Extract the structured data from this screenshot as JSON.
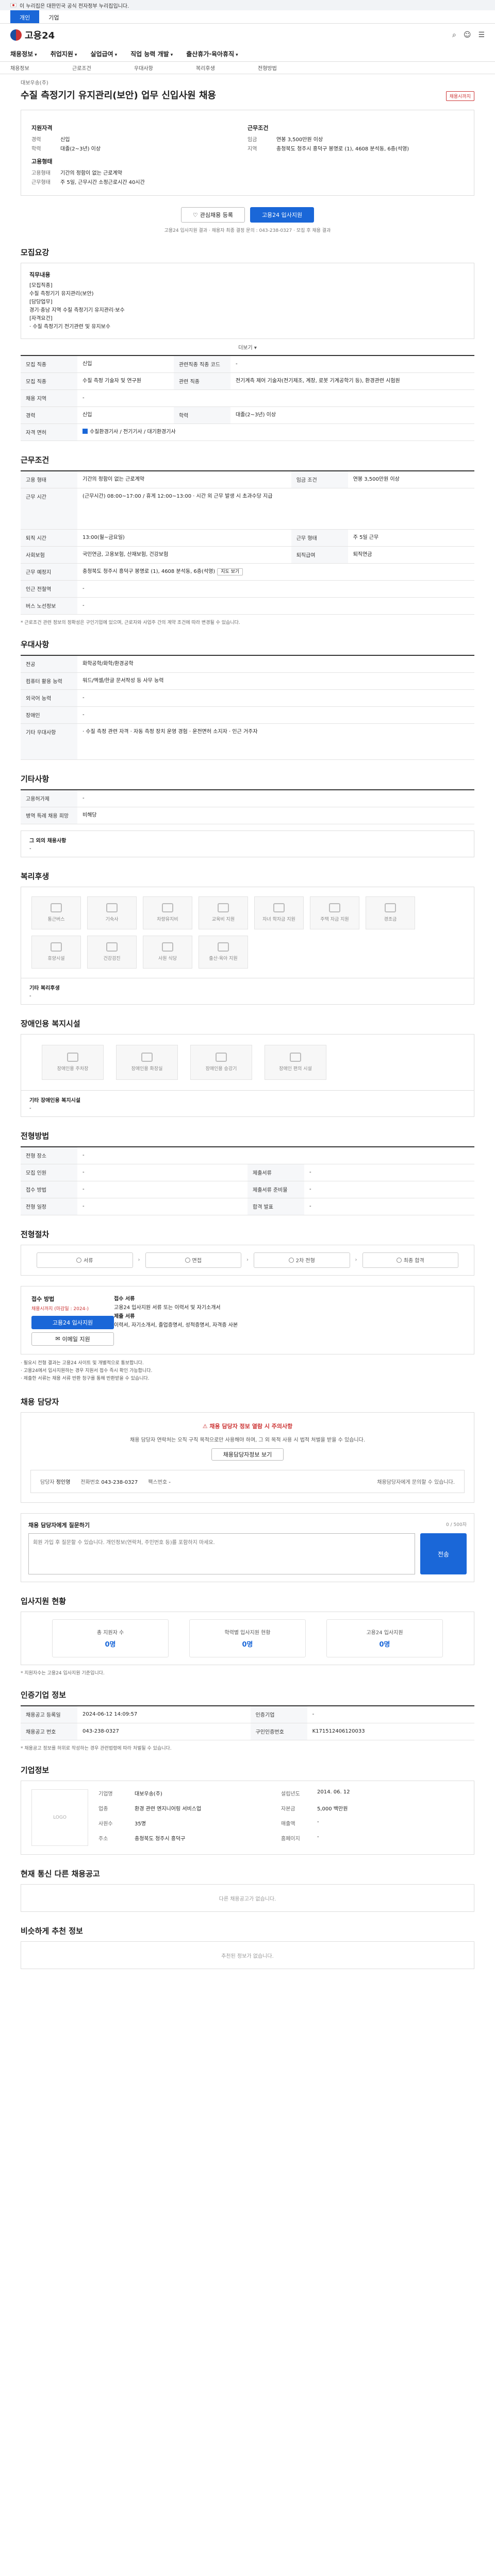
{
  "gov": {
    "text": "이 누리집은 대한민국 공식 전자정부 누리집입니다."
  },
  "tabs": [
    "개인",
    "기업"
  ],
  "logo": "고용24",
  "gnb": [
    "채용정보",
    "취업지원",
    "실업급여",
    "직업 능력 개발",
    "출산휴가·육아휴직"
  ],
  "snb": [
    "채용정보",
    "근로조건",
    "우대사항",
    "복리후생",
    "전형방법"
  ],
  "post": {
    "crumb": "대보우송(주)",
    "title": "수질 측정기기 유지관리(보안) 업무 신입사원 채용",
    "badge": "채용시까지",
    "summary_left_h": "지원자격",
    "summary_left": [
      {
        "k": "경력",
        "v": "신입"
      },
      {
        "k": "학력",
        "v": "대졸(2~3년) 이상"
      }
    ],
    "summary_left_h2": "고용형태",
    "summary_left2": [
      {
        "k": "고용형태",
        "v": "기간의 정함이 없는 근로계약"
      },
      {
        "k": "근무형태",
        "v": "주 5일, 근무시간 소정근로시간 40시간"
      }
    ],
    "summary_right_h": "근무조건",
    "summary_right": [
      {
        "k": "임금",
        "v": "연봉 3,500만원 이상"
      },
      {
        "k": "지역",
        "v": "충청북도 청주시 흥덕구 봉명로 (1), 4608 분석동, 6층(석영)"
      }
    ],
    "btn_like": "관심채용 등록",
    "btn_apply": "고용24 입사지원",
    "apply_note": "고용24 입사지원 결과 · 채용자 최종 결정 문의 : 043-238-0327 · 모집 후 채용 결과"
  },
  "recruit": {
    "h": "모집요강",
    "job_h": "직무내용",
    "job_lines": [
      "[모집직종]",
      "수질 측정기기 유지관리(보안)",
      "[담당업무]",
      "경기·충남 지역 수질 측정기기 유지관리·보수",
      "[자격요건]",
      "· 수질 측정기기 전기관련 및 유지보수"
    ],
    "more": "더보기 ▾",
    "rows": [
      {
        "k": "모집 직종",
        "v": "신입",
        "k2": "관련직종 직종 코드",
        "v2": "-"
      },
      {
        "k": "모집 직종",
        "v": "수질 측정 기술자 및 연구원",
        "k2": "관련 직종",
        "v2": "전기계측 제어 기술자(전기제조, 계장, 로봇 기계공학기 등), 환경관련 시험원"
      },
      {
        "k": "채용 지역",
        "v": "-",
        "k2": "",
        "v2": ""
      },
      {
        "k": "경력",
        "v": "신입",
        "k2": "학력",
        "v2": "대졸(2~3년) 이상"
      },
      {
        "k": "자격 면허",
        "v": "수질환경기사 / 전기기사 / 대기환경기사",
        "k2": "",
        "v2": ""
      }
    ]
  },
  "cond": {
    "h": "근무조건",
    "rows": [
      {
        "k": "고용 형태",
        "v": "기간의 정함이 없는 근로계약",
        "k2": "임금 조건",
        "v2": "연봉 3,500만원 이상"
      },
      {
        "k": "근무 시간",
        "v": "(근무시간) 08:00~17:00 / 휴게 12:00~13:00 · 시간 외 근무 발생 시 초과수당 지급",
        "k2": "",
        "v2": ""
      },
      {
        "k": "퇴직 시간",
        "v": "13:00(월~금요일)",
        "k2": "근무 형태",
        "v2": "주 5일 근무"
      },
      {
        "k": "사회보험",
        "v": "국민연금, 고용보험, 산재보험, 건강보험",
        "k2": "퇴직급여",
        "v2": "퇴직연금"
      },
      {
        "k": "근무 예정지",
        "v": "충청북도 청주시 흥덕구 봉명로 (1), 4608 분석동, 6층(석영)",
        "k2": "",
        "v2": ""
      },
      {
        "k": "인근 전철역",
        "v": "-",
        "k2": "",
        "v2": ""
      },
      {
        "k": "버스 노선정보",
        "v": "-",
        "k2": "",
        "v2": ""
      }
    ],
    "note": "* 근로조건 관련 정보의 정확성은 구인기업에 있으며, 근로자와 사업주 간의 계약 조건에 따라 변경될 수 있습니다."
  },
  "pref": {
    "h": "우대사항",
    "rows": [
      {
        "k": "전공",
        "v": "화학공학/화학/환경공학"
      },
      {
        "k": "컴퓨터 활용 능력",
        "v": "워드/엑셀/한글 문서작성 등 사무 능력"
      },
      {
        "k": "외국어 능력",
        "v": "-"
      },
      {
        "k": "장애인",
        "v": "-"
      },
      {
        "k": "기타 우대사항",
        "v": "· 수질 측정 관련 자격 · 자동 측정 장치 운영 경험 · 운전면허 소지자 · 인근 거주자"
      }
    ]
  },
  "etc": {
    "h": "기타사항",
    "rows": [
      {
        "k": "고용허가제",
        "v": "-"
      },
      {
        "k": "병역 특례 채용 희망",
        "v": "비해당"
      }
    ],
    "sub_h": "그 외의 채용사항",
    "sub_v": "-"
  },
  "welfare": {
    "h": "복리후생",
    "cards": [
      "통근버스",
      "기숙사",
      "차량유지비",
      "교육비 지원",
      "자녀 학자금 지원",
      "주택 자금 지원",
      "경조금",
      "휴양시설",
      "건강검진",
      "사원 식당",
      "출산·육아 지원"
    ],
    "sub_h": "기타 복리후생",
    "sub_v": "-"
  },
  "disab": {
    "h": "장애인용 복지시설",
    "cards": [
      "장애인용 주차장",
      "장애인용 화장실",
      "장애인용 승강기",
      "장애인 편의 시설"
    ],
    "sub_h": "기타 장애인용 복지시설",
    "sub_v": "-"
  },
  "select": {
    "h": "전형방법",
    "rows": [
      {
        "k": "전형 장소",
        "v": "-",
        "k2": "",
        "v2": ""
      },
      {
        "k": "모집 인원",
        "v": "-",
        "k2": "제출서류",
        "v2": "-"
      },
      {
        "k": "접수 방법",
        "v": "-",
        "k2": "제출서류 준비물",
        "v2": "-"
      },
      {
        "k": "전형 일정",
        "v": "-",
        "k2": "합격 발표",
        "v2": "-"
      }
    ]
  },
  "process": {
    "h": "전형절차",
    "steps": [
      "서류",
      "면접",
      "2차 전형",
      "최종 합격"
    ]
  },
  "applyinfo": {
    "h": "접수 방법",
    "deadline": "채용시까지 (마감일 : 2024-)",
    "btn_apply": "고용24 입사지원",
    "btn_email": "이메일 지원",
    "docs_h": "접수 서류",
    "docs": "고용24 입사지원 서류 또는 이력서 및 자기소개서",
    "etc_h": "제출 서류",
    "etc": "이력서, 자기소개서, 졸업증명서, 성적증명서, 자격증 사본",
    "bullets": [
      "· 필요시 전형 결과는 고용24 사이트 및 개별적으로 통보합니다.",
      "· 고용24에서 입사지원하는 경우 지원서 접수 즉시 확인 가능합니다.",
      "· 제출한 서류는 채용 서류 반환 청구를 통해 반환받을 수 있습니다."
    ]
  },
  "manager": {
    "h": "채용 담당자",
    "warn": "⚠ 채용 담당자 정보 열람 시 주의사항",
    "msg": "채용 담당자 연락처는 오직 구직 목적으로만 사용해야 하며, 그 외 목적 사용 시 법적 처벌을 받을 수 있습니다.",
    "btn": "채용담당자정보 보기",
    "name_k": "담당자",
    "name_v": "정인영",
    "tel_k": "전화번호",
    "tel_v": "043-238-0327",
    "fax_k": "팩스번호",
    "note": "채용담당자에게 문의할 수 있습니다."
  },
  "qna": {
    "h": "채용 담당자에게 질문하기",
    "placeholder": "회원 가입 후 질문할 수 있습니다. 개인정보(연락처, 주민번호 등)를 포함하지 마세요.",
    "btn": "전송",
    "count": "0 / 500자"
  },
  "stats": {
    "h": "입사지원 현황",
    "items": [
      {
        "k": "총 지원자 수",
        "v": "0명"
      },
      {
        "k": "학력별 입사지원 현황",
        "v": "0명"
      },
      {
        "k": "고용24 입사지원",
        "v": "0명"
      }
    ],
    "note": "* 지원자수는 고용24 입사지원 기준입니다."
  },
  "pinfo": {
    "h": "인증기업 정보",
    "rows": [
      {
        "k": "채용공고 등록일",
        "v": "2024-06-12 14:09:57",
        "k2": "인증기업",
        "v2": "-"
      },
      {
        "k": "채용공고 번호",
        "v": "043-238-0327",
        "k2": "구인인증번호",
        "v2": "K171512406120033"
      }
    ],
    "note": "* 채용공고 정보를 허위로 작성하는 경우 관련법령에 따라 처벌될 수 있습니다."
  },
  "company": {
    "h": "기업정보",
    "logo": "LOGO",
    "rows": [
      {
        "k": "기업명",
        "v": "대보우송(주)",
        "k2": "설립년도",
        "v2": "2014. 06. 12"
      },
      {
        "k": "업종",
        "v": "환경 관련 엔지니어링 서비스업",
        "k2": "자본금",
        "v2": "5,000 백만원"
      },
      {
        "k": "사원수",
        "v": "35명",
        "k2": "매출액",
        "v2": "-"
      },
      {
        "k": "주소",
        "v": "충청북도 청주시 흥덕구",
        "k2": "홈페이지",
        "v2": "-"
      }
    ]
  },
  "other": {
    "h": "현재 통신 다른 채용공고",
    "empty": "다른 채용공고가 없습니다."
  },
  "rec": {
    "h": "비슷하게 추천 정보",
    "empty": "추천된 정보가 없습니다."
  }
}
